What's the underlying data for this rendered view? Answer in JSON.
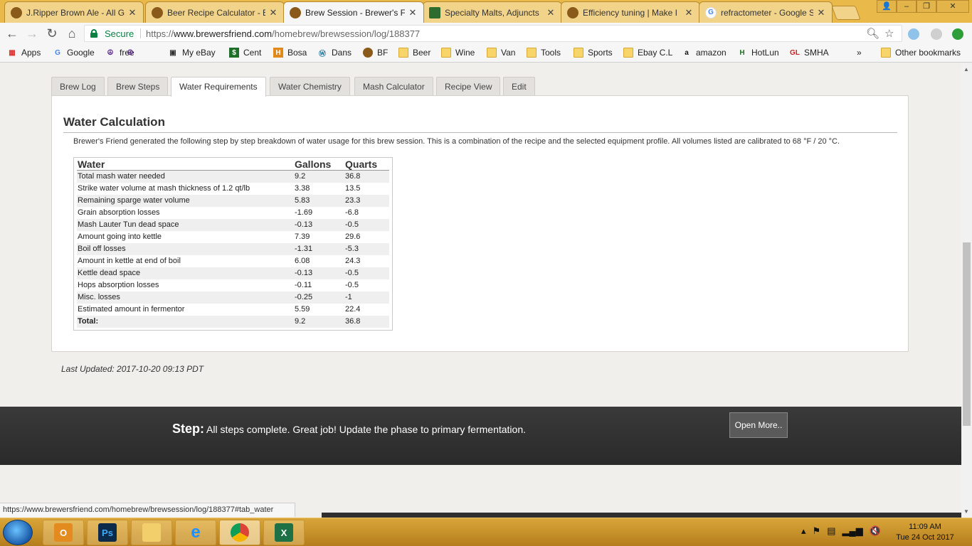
{
  "browser": {
    "tabs": [
      {
        "title": "J.Ripper Brown Ale - All G",
        "active": false
      },
      {
        "title": "Beer Recipe Calculator - E",
        "active": false
      },
      {
        "title": "Brew Session - Brewer's F",
        "active": true
      },
      {
        "title": "Specialty Malts, Adjuncts",
        "active": false
      },
      {
        "title": "Efficiency tuning | Make I",
        "active": false
      },
      {
        "title": "refractometer - Google S",
        "active": false
      }
    ],
    "secure_label": "Secure",
    "url_scheme": "https://",
    "url_host": "www.brewersfriend.com",
    "url_path": "/homebrew/brewsession/log/188377",
    "bookmarks": [
      "Apps",
      "Google",
      "free",
      "My eBay",
      "Cent",
      "Bosa",
      "Dans",
      "BF",
      "Beer",
      "Wine",
      "Van",
      "Tools",
      "Sports",
      "Ebay C.L",
      "amazon",
      "HotLun",
      "SMHA"
    ],
    "bookmarks_more": "»",
    "other_bookmarks": "Other bookmarks",
    "status_url": "https://www.brewersfriend.com/homebrew/brewsession/log/188377#tab_water"
  },
  "page": {
    "tabs": [
      {
        "label": "Brew Log",
        "active": false
      },
      {
        "label": "Brew Steps",
        "active": false
      },
      {
        "label": "Water Requirements",
        "active": true
      },
      {
        "label": "Water Chemistry",
        "active": false
      },
      {
        "label": "Mash Calculator",
        "active": false
      },
      {
        "label": "Recipe View",
        "active": false
      },
      {
        "label": "Edit",
        "active": false
      }
    ],
    "panel_title": "Water Calculation",
    "description": "Brewer's Friend generated the following step by step breakdown of water usage for this brew session. This is a combination of the recipe and the selected equipment profile. All volumes listed are calibrated to 68 °F / 20 °C.",
    "table": {
      "headers": [
        "Water",
        "Gallons",
        "Quarts"
      ],
      "rows": [
        {
          "label": "Total mash water needed",
          "gallons": "9.2",
          "quarts": "36.8"
        },
        {
          "label": "Strike water volume at mash thickness of 1.2 qt/lb",
          "gallons": "3.38",
          "quarts": "13.5"
        },
        {
          "label": "Remaining sparge water volume",
          "gallons": "5.83",
          "quarts": "23.3"
        },
        {
          "label": "Grain absorption losses",
          "gallons": "-1.69",
          "quarts": "-6.8"
        },
        {
          "label": "Mash Lauter Tun dead space",
          "gallons": "-0.13",
          "quarts": "-0.5"
        },
        {
          "label": "Amount going into kettle",
          "gallons": "7.39",
          "quarts": "29.6"
        },
        {
          "label": "Boil off losses",
          "gallons": "-1.31",
          "quarts": "-5.3"
        },
        {
          "label": "Amount in kettle at end of boil",
          "gallons": "6.08",
          "quarts": "24.3"
        },
        {
          "label": "Kettle dead space",
          "gallons": "-0.13",
          "quarts": "-0.5"
        },
        {
          "label": "Hops absorption losses",
          "gallons": "-0.11",
          "quarts": "-0.5"
        },
        {
          "label": "Misc. losses",
          "gallons": "-0.25",
          "quarts": "-1"
        },
        {
          "label": "Estimated amount in fermentor",
          "gallons": "5.59",
          "quarts": "22.4"
        }
      ],
      "total": {
        "label": "Total:",
        "gallons": "9.2",
        "quarts": "36.8"
      }
    },
    "last_updated": "Last Updated: 2017-10-20 09:13 PDT",
    "step_label": "Step:",
    "step_text": "All steps complete. Great job! Update the phase to primary fermentation.",
    "open_more": "Open More.."
  },
  "taskbar": {
    "time": "11:09 AM",
    "date": "Tue 24 Oct 2017"
  },
  "colors": {
    "accent_orange": "#e9b949",
    "secure_green": "#0b8043",
    "step_bar": "#2e2e2e"
  }
}
